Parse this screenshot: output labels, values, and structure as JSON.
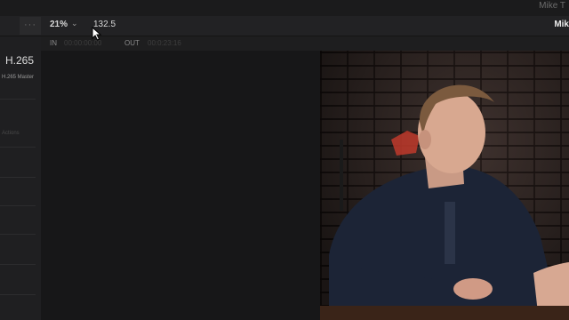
{
  "app": {
    "user_name": "Mike T"
  },
  "toolbar": {
    "more_label": "···",
    "zoom_value": "21%",
    "timecode_field": "132.5",
    "right_truncated_text": "Mik"
  },
  "viewer": {
    "in_label": "IN",
    "in_timecode": "00:00:00:00",
    "out_label": "OUT",
    "out_timecode": "00:0:23:16"
  },
  "render_settings": {
    "codec": "H.265",
    "preset_label": "H.265 Master",
    "faint_label": "Actions"
  },
  "colors": {
    "background": "#161617",
    "panel": "#1f1f21",
    "toolbar": "#222224"
  },
  "icons": [
    "more-dots-icon",
    "chevron-down-icon",
    "mouse-cursor-icon"
  ]
}
